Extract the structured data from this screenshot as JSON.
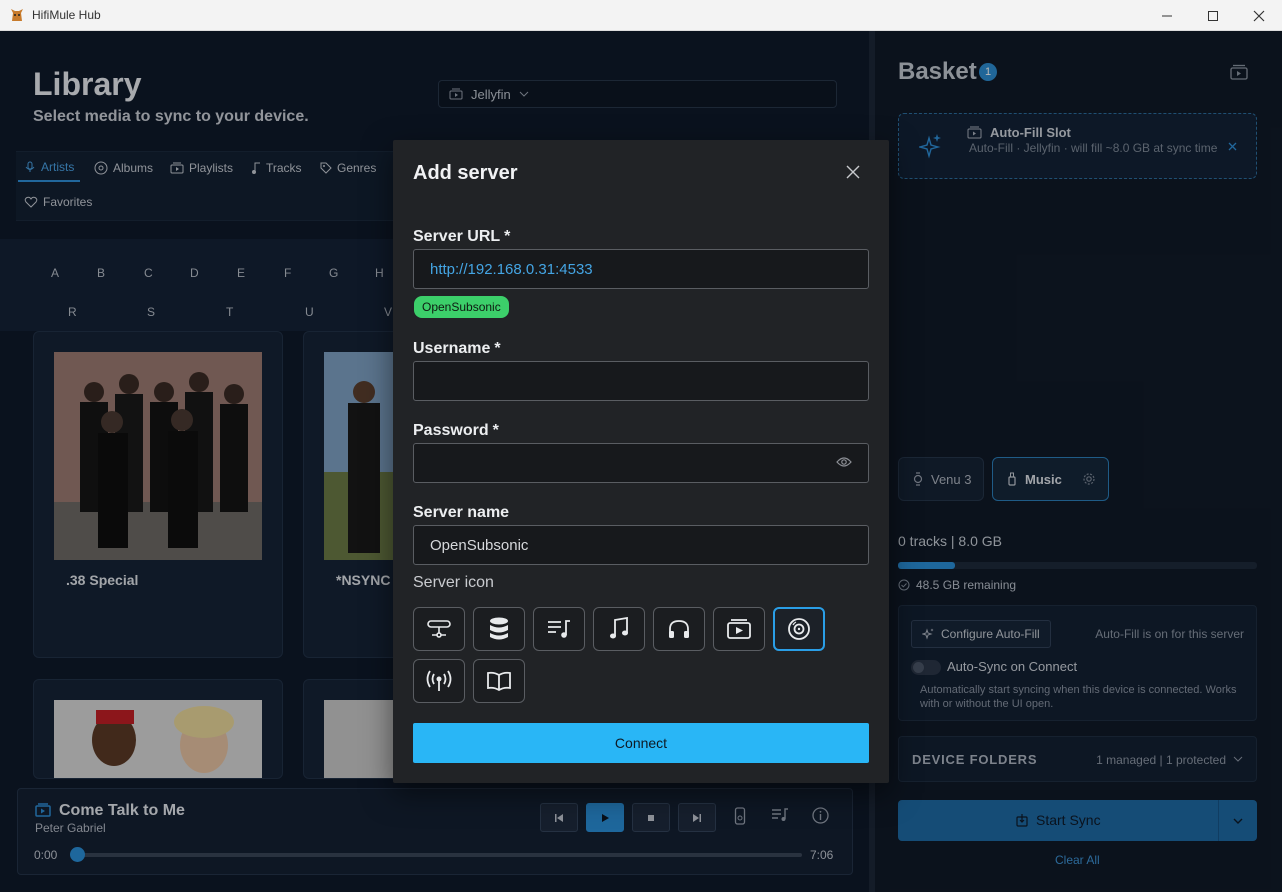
{
  "window": {
    "title": "HifiMule Hub"
  },
  "library": {
    "title": "Library",
    "subtitle": "Select media to sync to your device.",
    "server_select": "Jellyfin",
    "tabs": [
      {
        "label": "Artists"
      },
      {
        "label": "Albums"
      },
      {
        "label": "Playlists"
      },
      {
        "label": "Tracks"
      },
      {
        "label": "Genres"
      },
      {
        "label": "Favorites"
      }
    ],
    "letters_row1": [
      "A",
      "B",
      "C",
      "D",
      "E",
      "F",
      "G",
      "H"
    ],
    "letters_row2": [
      "R",
      "S",
      "T",
      "U",
      "V"
    ],
    "artists": [
      {
        "name": ".38 Special"
      },
      {
        "name": "*NSYNC"
      }
    ]
  },
  "player": {
    "title": "Come Talk to Me",
    "artist": "Peter Gabriel",
    "elapsed": "0:00",
    "duration": "7:06",
    "progress": 0.0
  },
  "basket": {
    "title": "Basket",
    "count": "1",
    "autofill_slot": {
      "title": "Auto-Fill Slot",
      "desc": "Auto-Fill · Jellyfin · will fill ~8.0 GB at sync time"
    },
    "devices": [
      {
        "label": "Venu 3"
      },
      {
        "label": "Music"
      }
    ],
    "stats": "0 tracks | 8.0 GB",
    "capacity_fraction": 0.16,
    "remaining": "48.5 GB remaining",
    "configure_label": "Configure Auto-Fill",
    "autofill_on": "Auto-Fill is on for this server",
    "autosync_label": "Auto-Sync on Connect",
    "autosync_desc": "Automatically start syncing when this device is connected. Works with or without the UI open.",
    "folders_label": "DEVICE FOLDERS",
    "folders_info": "1 managed | 1 protected",
    "sync_label": "Start Sync",
    "clear_label": "Clear All"
  },
  "modal": {
    "title": "Add server",
    "url_label": "Server URL",
    "url_value": "http://192.168.0.31:4533",
    "server_type_badge": "OpenSubsonic",
    "username_label": "Username",
    "username_value": "",
    "password_label": "Password",
    "password_value": "",
    "name_label": "Server name",
    "name_value": "OpenSubsonic",
    "icon_label": "Server icon",
    "required_mark": "*",
    "connect_label": "Connect"
  },
  "colors": {
    "accent": "#29b6f6",
    "badge_green": "#3ccf6a",
    "primary_blue": "#2a8fd8"
  }
}
